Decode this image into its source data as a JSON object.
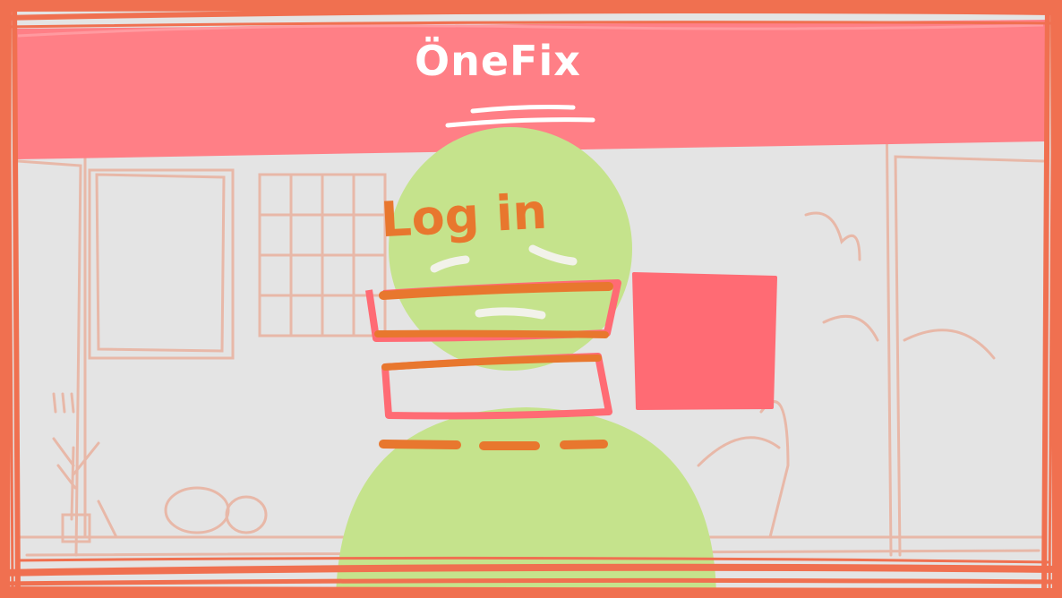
{
  "header": {
    "app_name": "ÖneFix"
  },
  "login": {
    "heading": "Log in"
  },
  "colors": {
    "frame": "#f07050",
    "header_band": "#ff7f86",
    "background": "#e4e4e4",
    "figure_green": "#c5e38c",
    "accent_orange": "#e8772e",
    "button_pink": "#ff6b74",
    "sketch_lines": "#e8b8a8"
  }
}
